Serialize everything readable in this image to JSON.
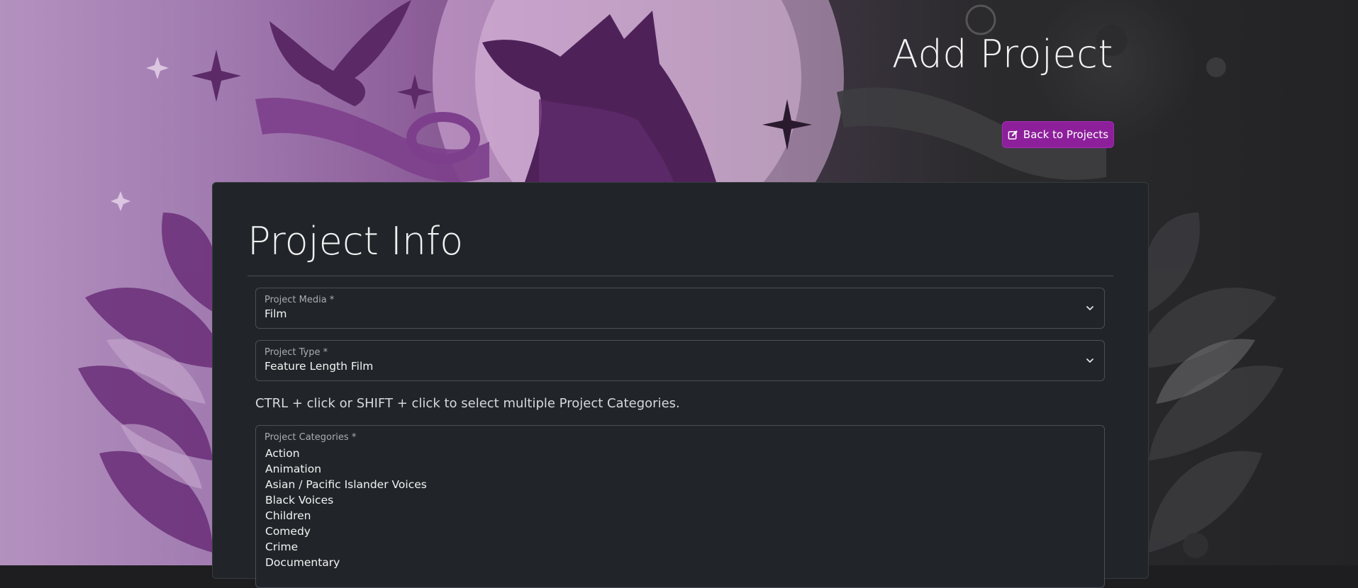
{
  "header": {
    "title": "Add Project",
    "back_button_label": "Back to Projects",
    "back_button_icon": "edit-icon"
  },
  "card": {
    "title": "Project Info",
    "project_media": {
      "label": "Project Media *",
      "value": "Film"
    },
    "project_type": {
      "label": "Project Type *",
      "value": "Feature Length Film"
    },
    "help_text": "CTRL + click or SHIFT + click to select multiple Project Categories.",
    "project_categories": {
      "label": "Project Categories *",
      "options": [
        "Action",
        "Animation",
        "Asian / Pacific Islander Voices",
        "Black Voices",
        "Children",
        "Comedy",
        "Crime",
        "Documentary"
      ]
    }
  },
  "colors": {
    "accent": "#8d1f9b",
    "card_background": "#212529",
    "border": "#495057"
  }
}
